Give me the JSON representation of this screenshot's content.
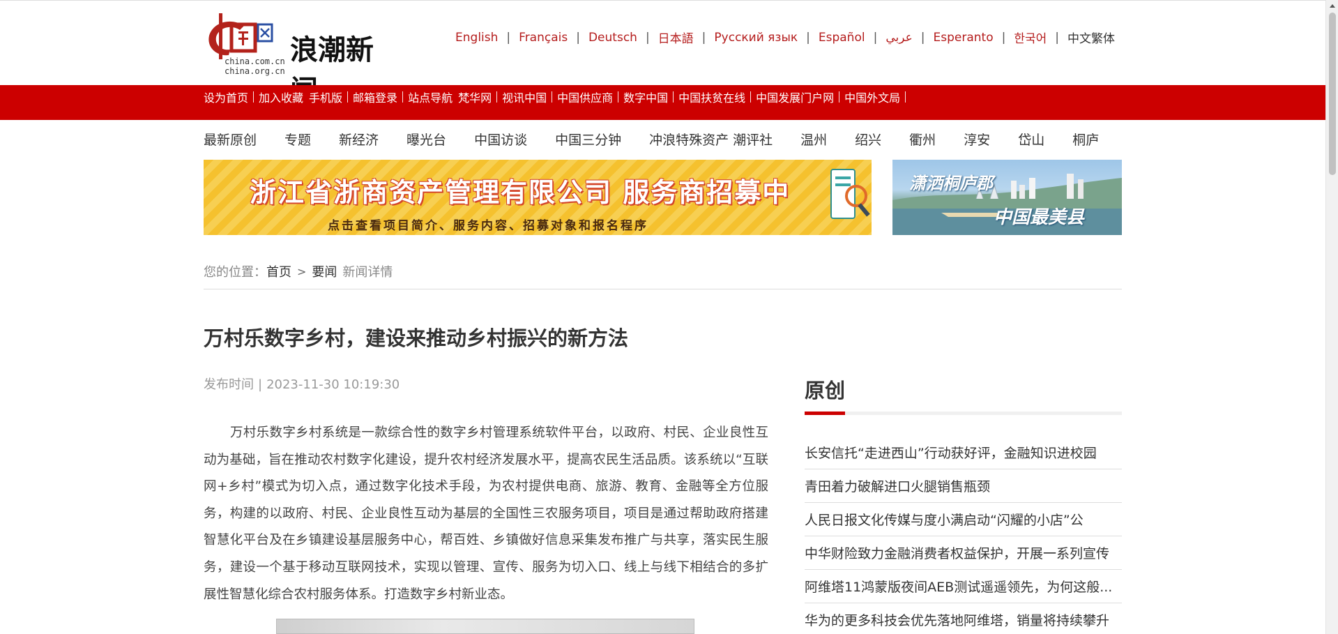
{
  "header": {
    "logo": {
      "mark_text": "中国网",
      "domain_line1": "china.com.cn",
      "domain_line2": "china.org.cn",
      "brand": "浪潮新闻"
    },
    "languages": [
      {
        "label": "English"
      },
      {
        "label": "Français"
      },
      {
        "label": "Deutsch"
      },
      {
        "label": "日本語"
      },
      {
        "label": "Русский язык"
      },
      {
        "label": "Español"
      },
      {
        "label": "عربي"
      },
      {
        "label": "Esperanto"
      },
      {
        "label": "한국어"
      },
      {
        "label": "中文繁体"
      }
    ]
  },
  "red_nav": [
    [
      "设为首页"
    ],
    [
      "加入收藏",
      "手机版"
    ],
    [
      "邮箱登录"
    ],
    [
      "站点导航",
      "梵华网"
    ],
    [
      "视讯中国"
    ],
    [
      "中国供应商"
    ],
    [
      "数字中国"
    ],
    [
      "中国扶贫在线"
    ],
    [
      "中国发展门户网"
    ],
    [
      "中国外文局"
    ]
  ],
  "channels": [
    "最新原创",
    "专题",
    "新经济",
    "曝光台",
    "中国访谈",
    "中国三分钟",
    "冲浪特殊资产",
    "潮评社",
    "温州",
    "绍兴",
    "衢州",
    "淳安",
    "岱山",
    "桐庐"
  ],
  "banners": {
    "left": {
      "title": "浙江省浙商资产管理有限公司  服务商招募中",
      "subtitle": "点击查看项目简介、服务内容、招募对象和报名程序"
    },
    "right": {
      "line1": "潇洒桐庐郡",
      "line2": "中国最美县"
    }
  },
  "breadcrumb": {
    "prefix": "您的位置：",
    "home": "首页",
    "separator": ">",
    "section": "要闻",
    "current": "新闻详情"
  },
  "article": {
    "title": "万村乐数字乡村，建设来推动乡村振兴的新方法",
    "pub_label": "发布时间",
    "pub_sep": "|",
    "pub_time": "2023-11-30 10:19:30",
    "body": "万村乐数字乡村系统是一款综合性的数字乡村管理系统软件平台，以政府、村民、企业良性互动为基础，旨在推动农村数字化建设，提升农村经济发展水平，提高农民生活品质。该系统以“互联网+乡村”模式为切入点，通过数字化技术手段，为农村提供电商、旅游、教育、金融等全方位服务，构建的以政府、村民、企业良性互动为基层的全国性三农服务项目，项目是通过帮助政府搭建智慧化平台及在乡镇建设基层服务中心，帮百姓、乡镇做好信息采集发布推广与共享，落实民生服务，建设一个基于移动互联网技术，实现以管理、宣传、服务为切入口、线上与线下相结合的多扩展性智慧化综合农村服务体系。打造数字乡村新业态。"
  },
  "sidebar": {
    "heading": "原创",
    "items": [
      "长安信托“走进西山”行动获好评，金融知识进校园",
      "青田着力破解进口火腿销售瓶颈",
      "人民日报文化传媒与度小满启动“闪耀的小店”公",
      "中华财险致力金融消费者权益保护，开展一系列宣传",
      "阿维塔11鸿蒙版夜间AEB测试遥遥领先，为何这般...",
      "华为的更多科技会优先落地阿维塔，销量将持续攀升"
    ]
  },
  "colors": {
    "brand_red": "#cc0000",
    "link_red": "#b51d1d",
    "text": "#333333",
    "muted": "#999999"
  }
}
